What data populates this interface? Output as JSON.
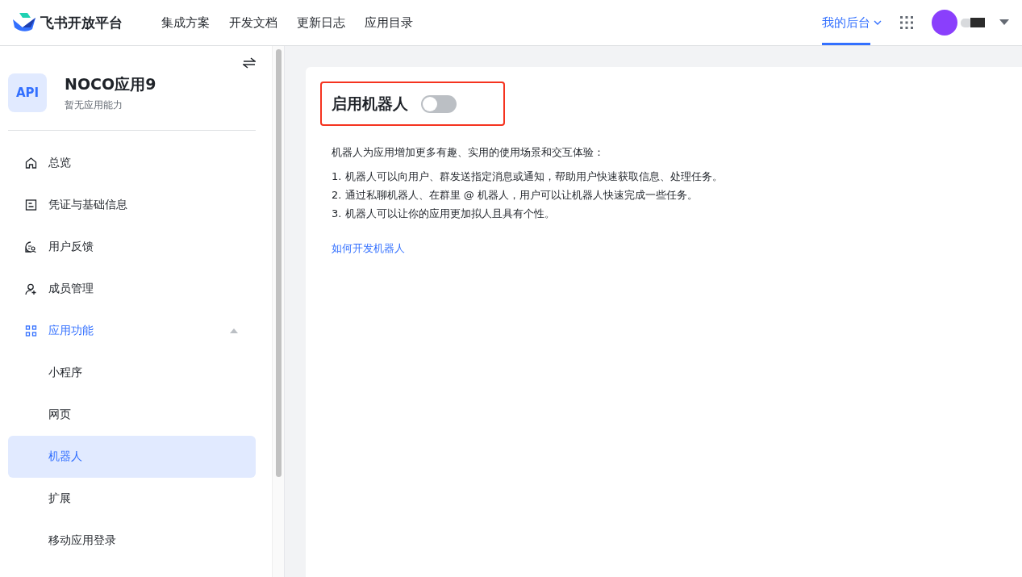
{
  "topbar": {
    "logo_text": "飞书开放平台",
    "nav": [
      {
        "label": "集成方案",
        "selected": false
      },
      {
        "label": "开发文档",
        "selected": false
      },
      {
        "label": "更新日志",
        "selected": false
      },
      {
        "label": "应用目录",
        "selected": false
      },
      {
        "label": "我的后台",
        "selected": true
      }
    ]
  },
  "app": {
    "name": "NOCO应用9",
    "subtitle": "暂无应用能力",
    "icon_text": "API"
  },
  "sidebar": {
    "items": [
      {
        "label": "总览",
        "selected": false
      },
      {
        "label": "凭证与基础信息",
        "selected": false
      },
      {
        "label": "用户反馈",
        "selected": false
      },
      {
        "label": "成员管理",
        "selected": false
      },
      {
        "label": "应用功能",
        "selected": false,
        "expanded": true,
        "children": [
          {
            "label": "小程序",
            "selected": false
          },
          {
            "label": "网页",
            "selected": false
          },
          {
            "label": "机器人",
            "selected": true
          },
          {
            "label": "扩展",
            "selected": false
          },
          {
            "label": "移动应用登录",
            "selected": false
          }
        ]
      }
    ]
  },
  "bot": {
    "title": "启用机器人",
    "enabled": false,
    "highlighted": true,
    "intro": "机器人为应用增加更多有趣、实用的使用场景和交互体验：",
    "points": [
      "1. 机器人可以向用户、群发送指定消息或通知，帮助用户快速获取信息、处理任务。",
      "2. 通过私聊机器人、在群里 @ 机器人，用户可以让机器人快速完成一些任务。",
      "3. 机器人可以让你的应用更加拟人且具有个性。"
    ],
    "link": "如何开发机器人"
  }
}
